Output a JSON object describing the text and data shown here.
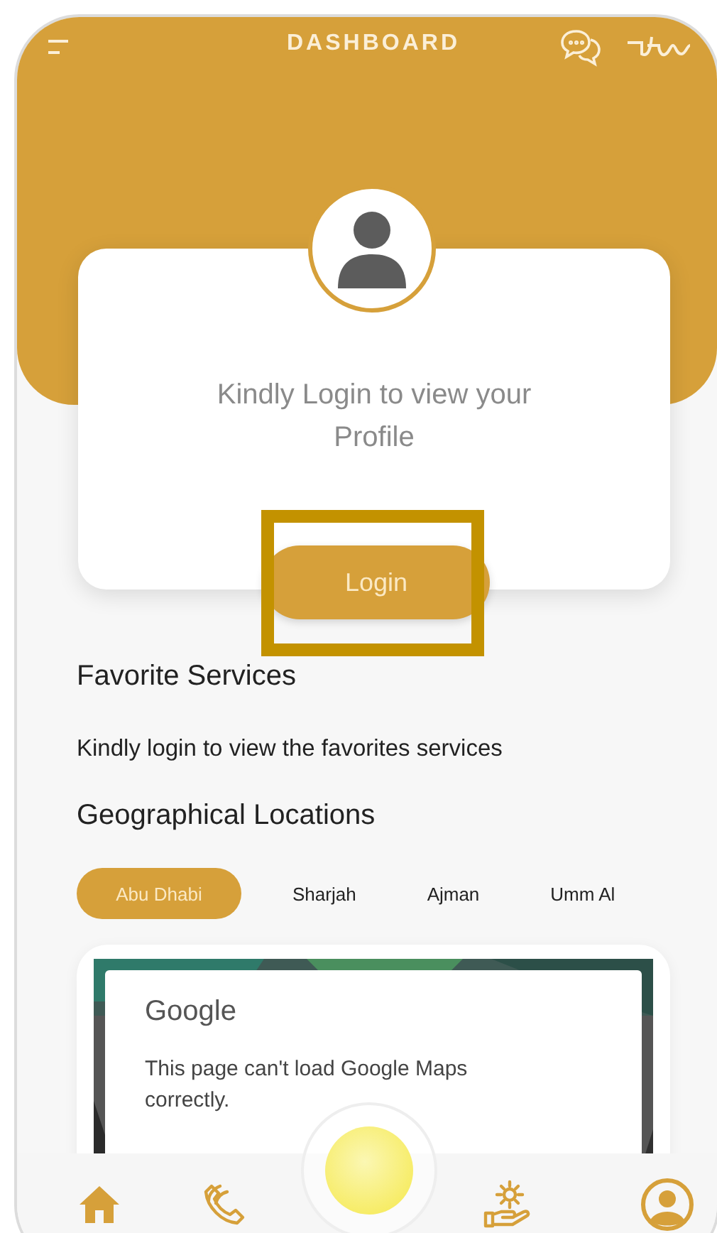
{
  "header": {
    "title": "DASHBOARD"
  },
  "profile_card": {
    "message": "Kindly Login to view your Profile",
    "login_button": "Login"
  },
  "favorites": {
    "title": "Favorite Services",
    "message": "Kindly login to view the favorites services"
  },
  "locations": {
    "title": "Geographical Locations",
    "tabs": [
      {
        "label": "Abu Dhabi",
        "selected": true
      },
      {
        "label": "Sharjah",
        "selected": false
      },
      {
        "label": "Ajman",
        "selected": false
      },
      {
        "label": "Umm Al",
        "selected": false
      }
    ]
  },
  "map": {
    "kind": "picture",
    "dialog_title": "Google",
    "dialog_message": "This page can't load Google Maps correctly."
  },
  "bottom_nav": [
    {
      "kind": "home"
    },
    {
      "kind": "calls"
    },
    {
      "kind": "center"
    },
    {
      "kind": "services"
    },
    {
      "kind": "profile"
    }
  ]
}
